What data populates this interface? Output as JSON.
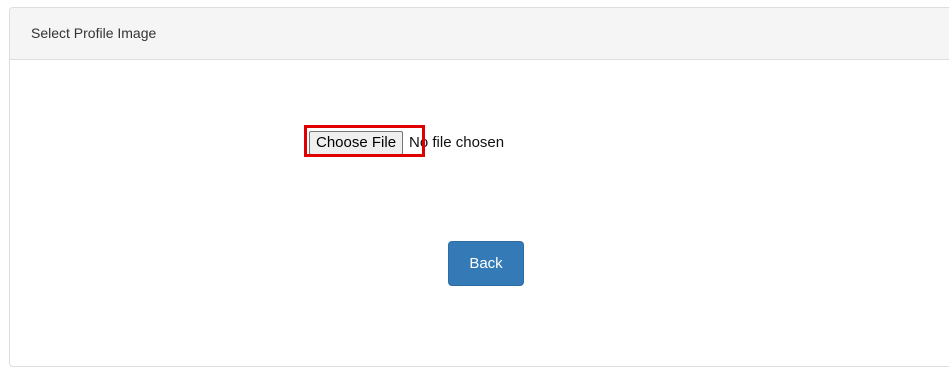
{
  "panel": {
    "heading": "Select Profile Image"
  },
  "file_input": {
    "button_label": "Choose File",
    "status_text": "No file chosen"
  },
  "back_button": {
    "label": "Back"
  },
  "colors": {
    "highlight": "#e00000",
    "primary_button": "#337ab7"
  }
}
